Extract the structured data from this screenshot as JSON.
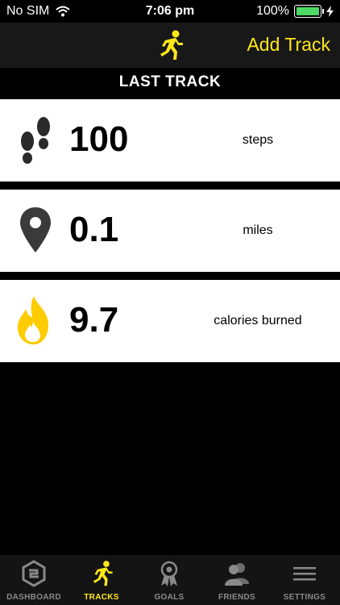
{
  "status_bar": {
    "carrier": "No SIM",
    "time": "7:06 pm",
    "battery": "100%",
    "battery_level": 1.0
  },
  "nav": {
    "action_label": "Add Track",
    "icon": "runner-icon"
  },
  "section": {
    "title": "LAST TRACK"
  },
  "stats": [
    {
      "icon": "footprints-icon",
      "value": "100",
      "unit": "steps"
    },
    {
      "icon": "map-pin-icon",
      "value": "0.1",
      "unit": "miles"
    },
    {
      "icon": "flame-icon",
      "value": "9.7",
      "unit": "calories burned"
    }
  ],
  "tabs": [
    {
      "label": "DASHBOARD",
      "icon": "dashboard-icon"
    },
    {
      "label": "TRACKS",
      "icon": "runner-icon",
      "active": true
    },
    {
      "label": "GOALS",
      "icon": "ribbon-icon"
    },
    {
      "label": "FRIENDS",
      "icon": "friends-icon"
    },
    {
      "label": "SETTINGS",
      "icon": "menu-icon"
    }
  ],
  "colors": {
    "accent": "#ffe81a",
    "battery": "#4cd964",
    "tab_inactive": "#8a8a8a",
    "background": "#000000"
  }
}
